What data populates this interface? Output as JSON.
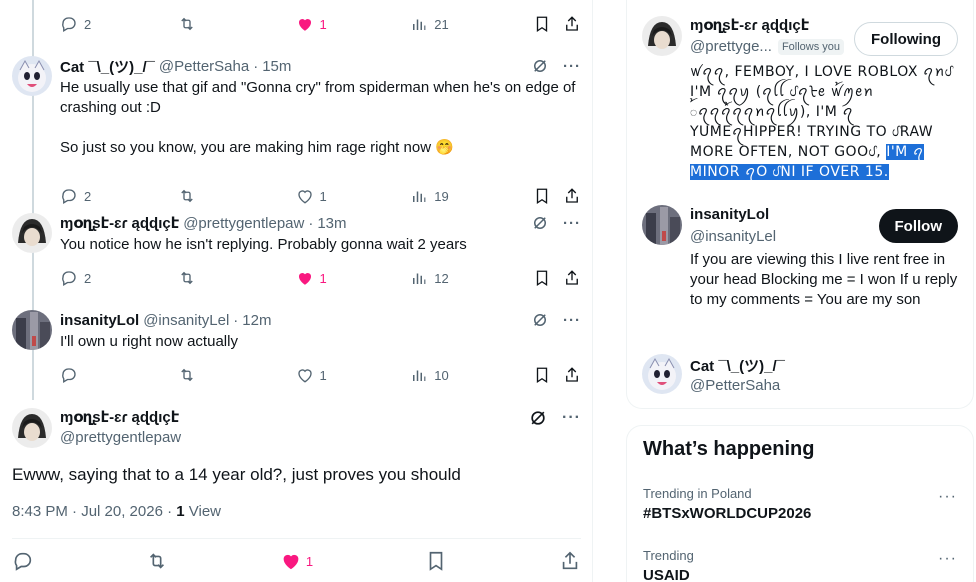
{
  "thread": {
    "top_actions": {
      "replies": "2",
      "likes": "1",
      "views": "21"
    },
    "replies": [
      {
        "name": "Cat ¯\\_(ツ)_/¯",
        "handle": "@PetterSaha",
        "time": "15m",
        "text": "He usually use that gif and \"Gonna cry\" from spiderman when he's on edge of crashing out :D\n\nSo just so you know, you are making him rage right now 🤭",
        "replies": "2",
        "likes": "1",
        "views": "19",
        "liked": false
      },
      {
        "name": "ɱօղʂէ‑ɛɾ ąɖɖıçէ",
        "handle": "@prettygentlepaw",
        "time": "13m",
        "text": "You notice how he isn't replying. Probably gonna wait 2 years",
        "replies": "2",
        "likes": "1",
        "views": "12",
        "liked": true
      },
      {
        "name": "insanityLol",
        "handle": "@insanityLel",
        "time": "12m",
        "text": "I'll own u right now actually",
        "replies": "",
        "likes": "1",
        "views": "10",
        "liked": false
      }
    ],
    "focal": {
      "name": "ɱօղʂէ‑ɛɾ ąɖɖıçէ",
      "handle": "@prettygentlepaw",
      "text": "Ewww, saying that to a 14 year old?, just proves you should",
      "datetime": "8:43 PM · Jul 20, 2026 · ",
      "views_count": "1",
      "views_label": " View",
      "likes": "1"
    }
  },
  "sidebar": {
    "users": [
      {
        "name": "ɱօղʂէ‑ɛɾ ąɖɖıçէ",
        "handle": "@prettyge...",
        "follows_you": "Follows you",
        "button": "Following",
        "bio_plain": "ꪝꪖꪖ, FEMBOY, I LOVE ROBLOX ꪖꪀᦔ I'M ꪖꪖꪗ (ꪖꪶꪶ ᦔꪖᡶꫀ ꪝ꫁ꪑꫀꪀ ꫁ꪖꪖꪖ꫁ꪖꪖꪀꪖꪶꪶꪗ), I'M ꪖ YUMEꪖHIPPER! TRYING TO ᦔRAW MORE OFTEN, NOT GOOᦔ, ",
        "bio_selected": "I'M ꪖ MINOR ꪖO ᦔNI IF OVER 15."
      },
      {
        "name": "insanityLol",
        "handle": "@insanityLel",
        "button": "Follow",
        "bio": "If you are viewing this I live rent free in your head Blocking me = I won If u reply to my comments = You are my son"
      },
      {
        "name": "Cat ¯\\_(ツ)_/¯",
        "handle": "@PetterSaha"
      }
    ],
    "whats_happening": {
      "title": "What’s happening",
      "trends": [
        {
          "category": "Trending in Poland",
          "topic": "#BTSxWORLDCUP2026"
        },
        {
          "category": "Trending",
          "topic": "USAID"
        }
      ]
    }
  },
  "colors": {
    "like": "#f91880",
    "text": "#0f1419",
    "muted": "#536471",
    "selection": "#1d6fd8"
  }
}
